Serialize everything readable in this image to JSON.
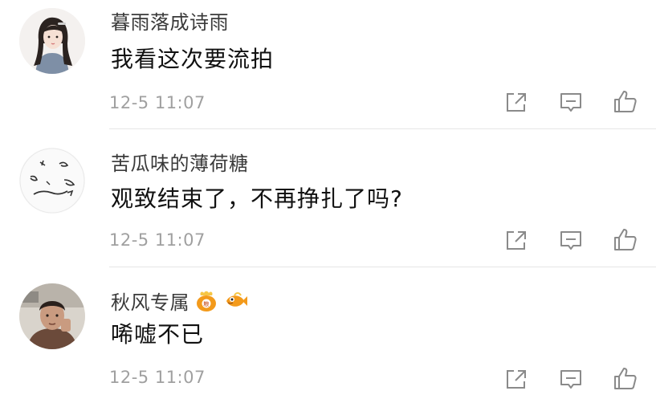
{
  "comments": [
    {
      "username": "暮雨落成诗雨",
      "text": "我看这次要流拍",
      "time": "12-5 11:07",
      "avatar_icon": "avatar-girl-icon"
    },
    {
      "username": "苦瓜味的薄荷糖",
      "text": "观致结束了，不再挣扎了吗?",
      "time": "12-5 11:07",
      "avatar_icon": "avatar-sketch-icon"
    },
    {
      "username": "秋风专属",
      "text": "唏嘘不已",
      "time": "12-5 11:07",
      "avatar_icon": "avatar-photo-icon",
      "badges": [
        "food-bag-badge-icon",
        "fish-badge-icon"
      ]
    }
  ],
  "colors": {
    "username": "#3a3a3a",
    "text": "#111111",
    "time": "#a0a0a0",
    "icon": "#8a8a8a",
    "badge_orange": "#f39a1b"
  }
}
